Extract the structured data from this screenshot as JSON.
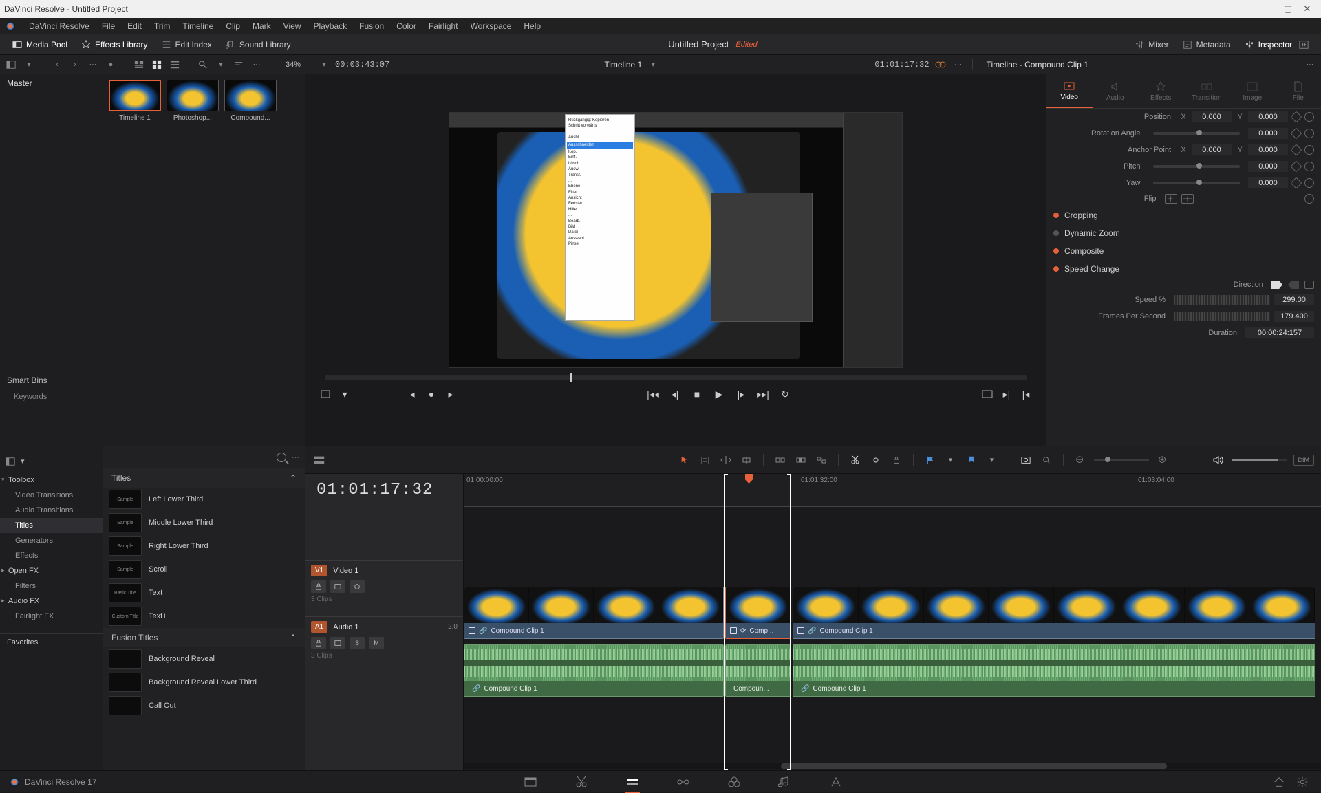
{
  "window": {
    "title": "DaVinci Resolve - Untitled Project"
  },
  "menubar": [
    "DaVinci Resolve",
    "File",
    "Edit",
    "Trim",
    "Timeline",
    "Clip",
    "Mark",
    "View",
    "Playback",
    "Fusion",
    "Color",
    "Fairlight",
    "Workspace",
    "Help"
  ],
  "toolbar": {
    "mediapool": "Media Pool",
    "effects": "Effects Library",
    "editindex": "Edit Index",
    "soundlib": "Sound Library",
    "project": "Untitled Project",
    "edited": "Edited",
    "mixer": "Mixer",
    "metadata": "Metadata",
    "inspector": "Inspector"
  },
  "quickbar": {
    "zoom": "34%",
    "srcTC": "00:03:43:07",
    "timelineName": "Timeline 1",
    "recTC": "01:01:17:32",
    "inspectorTitle": "Timeline - Compound Clip 1"
  },
  "mediapool": {
    "master": "Master",
    "clips": [
      {
        "name": "Timeline 1",
        "selected": true
      },
      {
        "name": "Photoshop..."
      },
      {
        "name": "Compound..."
      }
    ],
    "smartbins": "Smart Bins",
    "keywords": "Keywords"
  },
  "fx": {
    "tree": {
      "toolbox": "Toolbox",
      "videoTransitions": "Video Transitions",
      "audioTransitions": "Audio Transitions",
      "titles": "Titles",
      "generators": "Generators",
      "effects": "Effects",
      "openfx": "Open FX",
      "filters": "Filters",
      "audiofx": "Audio FX",
      "fairlightfx": "Fairlight FX",
      "favorites": "Favorites"
    },
    "catTitles": "Titles",
    "catFusion": "Fusion Titles",
    "items": [
      "Left Lower Third",
      "Middle Lower Third",
      "Right Lower Third",
      "Scroll",
      "Text",
      "Text+"
    ],
    "fusionItems": [
      "Background Reveal",
      "Background Reveal Lower Third",
      "Call Out"
    ],
    "previews": [
      "Sample",
      "Sample",
      "Sample",
      "Sample",
      "Basic Title",
      "Custom Title"
    ]
  },
  "inspector": {
    "tabs": [
      "Video",
      "Audio",
      "Effects",
      "Transition",
      "Image",
      "File"
    ],
    "position": "Position",
    "rotation": "Rotation Angle",
    "anchor": "Anchor Point",
    "pitch": "Pitch",
    "yaw": "Yaw",
    "flip": "Flip",
    "cropping": "Cropping",
    "dynzoom": "Dynamic Zoom",
    "composite": "Composite",
    "speedchange": "Speed Change",
    "direction": "Direction",
    "speedpct": "Speed %",
    "fps": "Frames Per Second",
    "duration": "Duration",
    "vals": {
      "posX": "0.000",
      "posY": "0.000",
      "rot": "0.000",
      "anchX": "0.000",
      "anchY": "0.000",
      "pitch": "0.000",
      "yaw": "0.000",
      "speed": "299.00",
      "fps": "179.400",
      "dur": "00:00:24:157"
    },
    "x": "X",
    "y": "Y"
  },
  "timeline": {
    "bigTC": "01:01:17:32",
    "ruler": [
      "01:00:00:00",
      "01:01:32:00",
      "01:03:04:00"
    ],
    "video1": "Video 1",
    "audio1": "Audio 1",
    "v1": "V1",
    "a1": "A1",
    "clips3": "3 Clips",
    "audCh": "2.0",
    "s": "S",
    "m": "M",
    "clipName": "Compound Clip 1",
    "clipNameShort": "Comp...",
    "clipNameMed": "Compoun..."
  },
  "toolbar2": {
    "dim": "DIM"
  },
  "bottombar": {
    "version": "DaVinci Resolve 17"
  }
}
